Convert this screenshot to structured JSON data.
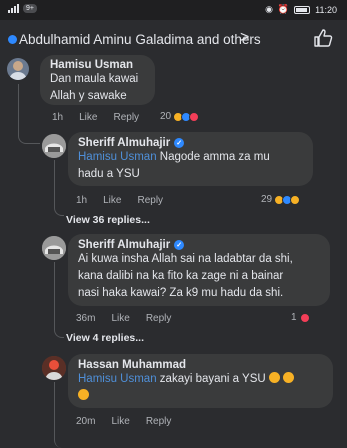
{
  "status_bar": {
    "carrier_label": "9+",
    "time": "11:20"
  },
  "header": {
    "title": "Abdulhamid Aminu Galadima and others"
  },
  "comments": [
    {
      "author": "Hamisu Usman",
      "lines": [
        "Dan maula kawai",
        "Allah y sawake"
      ],
      "time": "1h",
      "like": "Like",
      "reply": "Reply",
      "reactions": "20"
    },
    {
      "author": "Sheriff Almuhajir",
      "mention": "Hamisu Usman",
      "text_after": " Nagode amma za mu",
      "line2": "hadu a YSU",
      "time": "1h",
      "like": "Like",
      "reply": "Reply",
      "reactions": "29",
      "view_replies": "View 36 replies..."
    },
    {
      "author": "Sheriff Almuhajir",
      "lines": [
        "Ai kuwa insha Allah sai na ladabtar da shi,",
        "kana dalibi na ka fito ka zage ni a bainar",
        "nasi haka kawai? Za k9 mu hadu da shi."
      ],
      "time": "36m",
      "like": "Like",
      "reply": "Reply",
      "reactions": "1",
      "view_replies": "View 4 replies..."
    },
    {
      "author": "Hassan Muhammad",
      "mention": "Hamisu Usman",
      "text_after": " zakayi bayani a YSU",
      "time": "20m",
      "like": "Like",
      "reply": "Reply"
    }
  ],
  "colors": {
    "background": "#2b2c2f",
    "bubble": "#3a3b3c",
    "mention": "#4f8fd8",
    "verified": "#2e89ff"
  }
}
